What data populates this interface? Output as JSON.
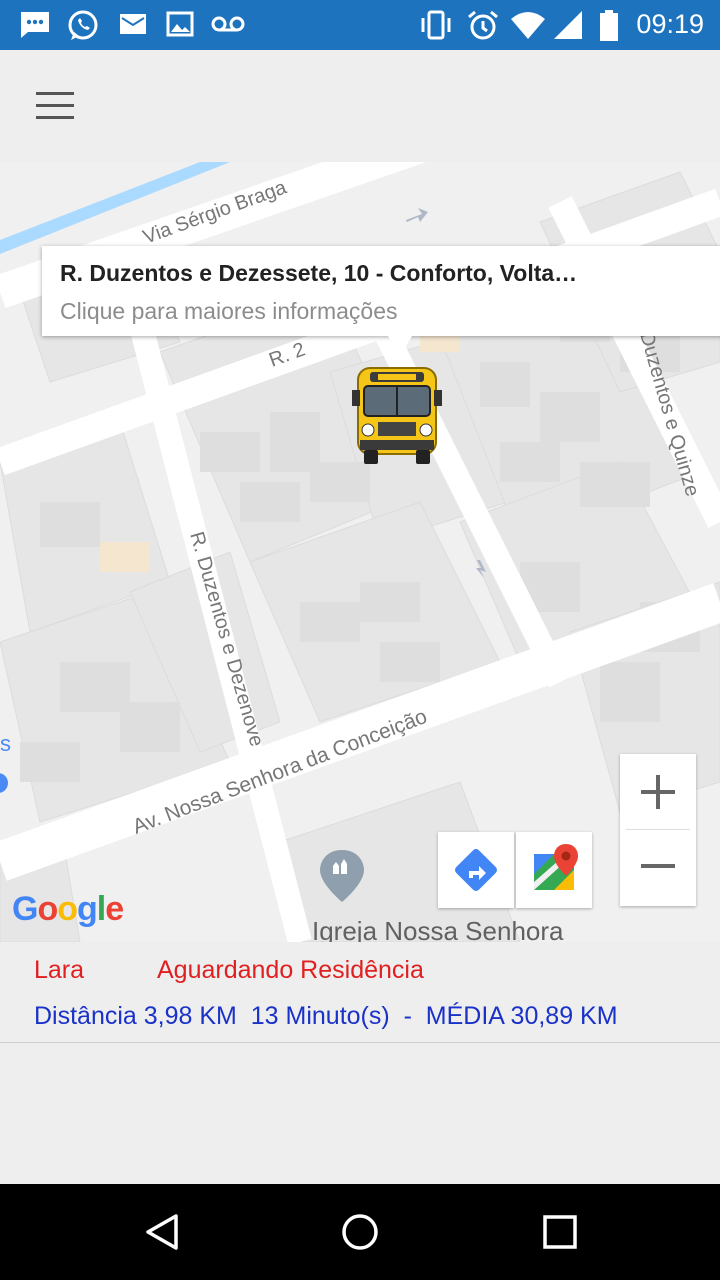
{
  "status_bar": {
    "time": "09:19",
    "left_icons": [
      "sms-icon",
      "whatsapp-icon",
      "email-icon",
      "image-icon",
      "voicemail-icon"
    ],
    "right_icons": [
      "vibrate-icon",
      "alarm-icon",
      "wifi-icon",
      "signal-icon",
      "battery-icon"
    ]
  },
  "toolbar": {
    "menu_icon": "hamburger-menu-icon"
  },
  "map": {
    "street_labels": [
      "Via Sérgio Braga",
      "R. 2",
      "R. Duzentos e Dezenove",
      "Av. Nossa Senhora da Conceição",
      "Duzentos e Quinze"
    ],
    "info_window": {
      "title": "R. Duzentos e Dezessete, 10 - Conforto, Volta…",
      "subtitle": "Clique para maiores informações"
    },
    "marker_icon": "school-bus-icon",
    "poi_label": "Igreja Nossa Senhora",
    "attribution": "Google",
    "zoom_in_label": "+",
    "zoom_out_label": "−",
    "directions_icon": "directions-icon",
    "open_maps_icon": "google-maps-icon"
  },
  "info_panel": {
    "name": "Lara",
    "status": "Aguardando Residência",
    "distance_line": "Distância 3,98 KM  13 Minuto(s)  -  MÉDIA 30,89 KM"
  },
  "colors": {
    "status_bar": "#1e73be",
    "name_status": "#e02020",
    "distance": "#1a32c8"
  },
  "nav_bar": {
    "back_icon": "back-icon",
    "home_icon": "home-icon",
    "recents_icon": "recents-icon"
  }
}
